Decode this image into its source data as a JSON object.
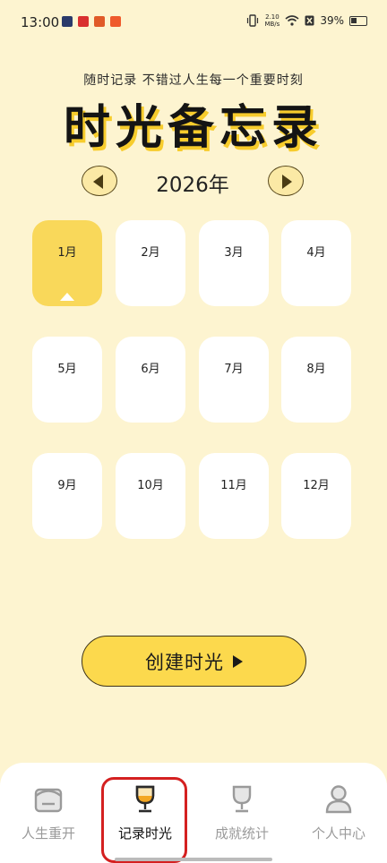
{
  "status_bar": {
    "time": "13:00",
    "network_speed_value": "2.10",
    "network_speed_unit": "MB/s",
    "battery": "39%"
  },
  "header": {
    "subtitle": "随时记录 不错过人生每一个重要时刻",
    "title": "时光备忘录"
  },
  "year_nav": {
    "year": "2026年",
    "prev_icon": "triangle-left-icon",
    "next_icon": "triangle-right-icon"
  },
  "months": [
    {
      "label": "1月",
      "selected": true
    },
    {
      "label": "2月",
      "selected": false
    },
    {
      "label": "3月",
      "selected": false
    },
    {
      "label": "4月",
      "selected": false
    },
    {
      "label": "5月",
      "selected": false
    },
    {
      "label": "6月",
      "selected": false
    },
    {
      "label": "7月",
      "selected": false
    },
    {
      "label": "8月",
      "selected": false
    },
    {
      "label": "9月",
      "selected": false
    },
    {
      "label": "10月",
      "selected": false
    },
    {
      "label": "11月",
      "selected": false
    },
    {
      "label": "12月",
      "selected": false
    }
  ],
  "create_button": {
    "label": "创建时光",
    "icon": "play-icon"
  },
  "bottom_nav": {
    "tabs": [
      {
        "label": "人生重开",
        "icon": "box-icon",
        "active": false
      },
      {
        "label": "记录时光",
        "icon": "trophy-icon",
        "active": true
      },
      {
        "label": "成就统计",
        "icon": "trophy-icon",
        "active": false
      },
      {
        "label": "个人中心",
        "icon": "person-icon",
        "active": false
      }
    ]
  },
  "colors": {
    "background": "#fdf4d0",
    "accent": "#f9d85a",
    "title_shadow": "#f7cc2c",
    "highlight": "#d42020"
  }
}
